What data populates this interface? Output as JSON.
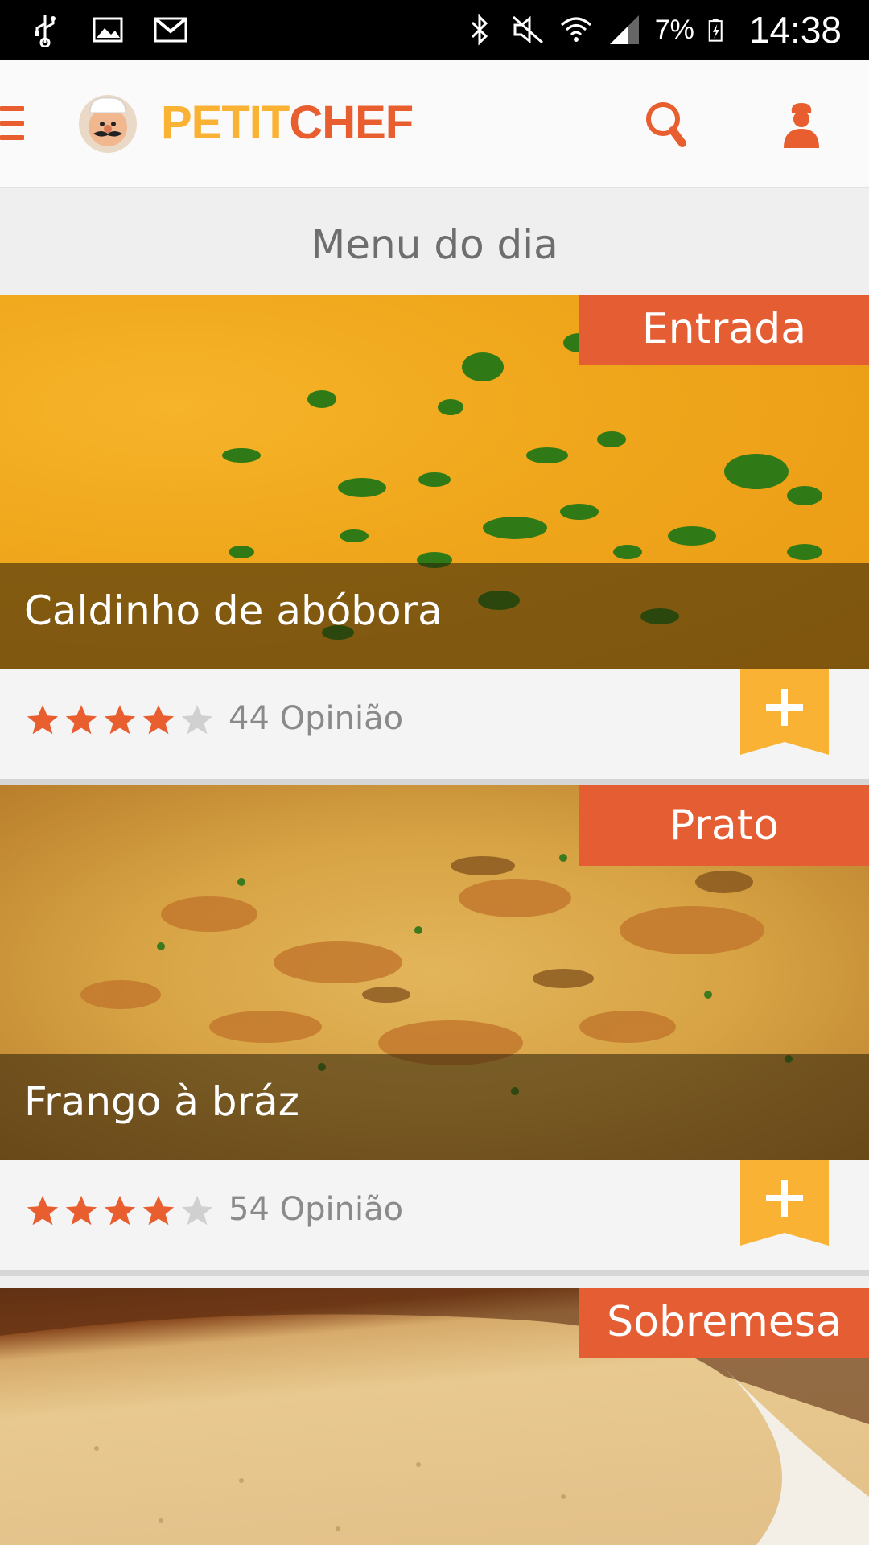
{
  "status_bar": {
    "battery": "7%",
    "time": "14:38"
  },
  "app_bar": {
    "logo_part1": "PETIT",
    "logo_part2": "CHEF"
  },
  "section": {
    "title": "Menu do dia"
  },
  "colors": {
    "accent": "#e55e33",
    "secondary": "#f9b233",
    "star_filled": "#e85e2f",
    "star_empty": "#d0d0d0"
  },
  "cards": [
    {
      "tag": "Entrada",
      "name": "Caldinho de abóbora",
      "rating": 4,
      "rating_max": 5,
      "reviews": "44 Opinião",
      "add_icon": "plus-bookmark-icon"
    },
    {
      "tag": "Prato",
      "name": "Frango à bráz",
      "rating": 4,
      "rating_max": 5,
      "reviews": "54 Opinião",
      "add_icon": "plus-bookmark-icon"
    },
    {
      "tag": "Sobremesa"
    }
  ]
}
